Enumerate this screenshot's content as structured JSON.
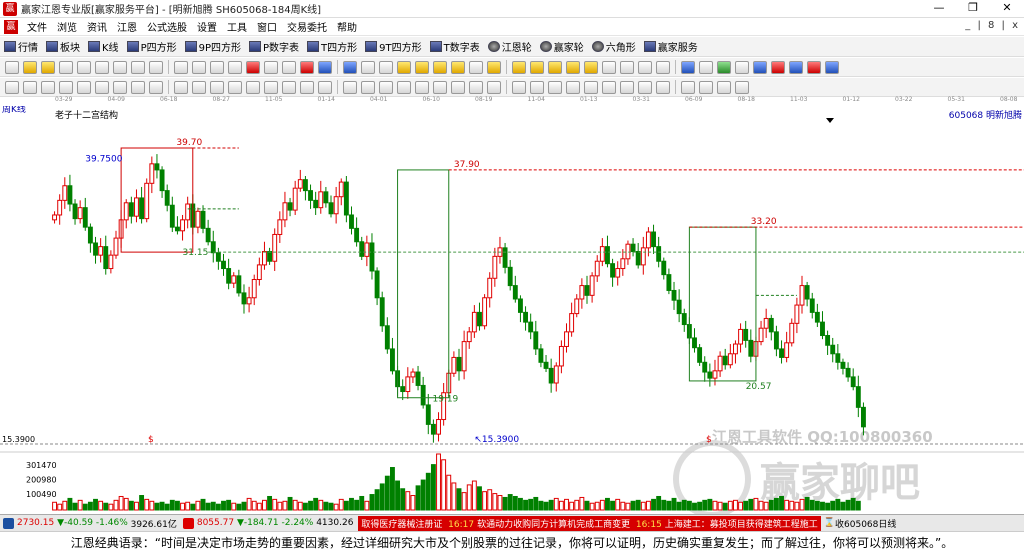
{
  "window": {
    "title": "赢家江恩专业版[赢家服务平台] - [明新旭腾  SH605068-184周K线]",
    "controls": [
      "—",
      "❐",
      "✕"
    ]
  },
  "menu": [
    "文件",
    "浏览",
    "资讯",
    "江恩",
    "公式选股",
    "设置",
    "工具",
    "窗口",
    "交易委托",
    "帮助"
  ],
  "menu_right": "_ | 8 | x",
  "toolbar1": [
    {
      "label": "行情",
      "icon": "quote-icon"
    },
    {
      "label": "板块",
      "icon": "sector-icon"
    },
    {
      "label": "K线",
      "icon": "kline-icon"
    },
    {
      "label": "P四方形",
      "icon": "p-square-icon"
    },
    {
      "label": "9P四方形",
      "icon": "9p-square-icon"
    },
    {
      "label": "P数字表",
      "icon": "p-table-icon"
    },
    {
      "label": "T四方形",
      "icon": "t-square-icon"
    },
    {
      "label": "9T四方形",
      "icon": "9t-square-icon"
    },
    {
      "label": "T数字表",
      "icon": "t-table-icon"
    },
    {
      "label": "江恩轮",
      "icon": "gann-wheel-icon"
    },
    {
      "label": "赢家轮",
      "icon": "winner-wheel-icon"
    },
    {
      "label": "六角形",
      "icon": "hexagon-icon"
    },
    {
      "label": "赢家服务",
      "icon": "service-icon"
    }
  ],
  "datebar_labels": [
    "03-29",
    "04-09",
    "06-18",
    "08-27",
    "11-05",
    "01-14",
    "04-01",
    "06-10",
    "08-19",
    "11-04",
    "01-13",
    "03-31",
    "06-09",
    "08-18",
    "11-03",
    "01-12",
    "03-22",
    "05-31",
    "08-08"
  ],
  "chart_header": {
    "period": "周K线",
    "indicator": "老子十二宫结构",
    "code_name": "605068  明新旭腾"
  },
  "chart_data": {
    "type": "candlestick",
    "annotations": {
      "high1": "39.70",
      "box1_top": "39.7500",
      "box1_low": "31.15",
      "high2": "37.90",
      "low2": "19.19",
      "low_marker": "15.3900",
      "high3": "33.20",
      "low3": "20.57"
    },
    "price_axis_label": "15.3900",
    "volume_axis": [
      "301470",
      "200980",
      "100490"
    ],
    "closes": [
      34.2,
      35.4,
      36.6,
      35.1,
      33.9,
      34.8,
      33.2,
      31.9,
      30.9,
      31.6,
      29.8,
      30.9,
      32.3,
      33.8,
      35.2,
      34.1,
      35.6,
      33.9,
      36.8,
      38.4,
      37.9,
      36.2,
      35.0,
      33.2,
      32.9,
      33.8,
      35.1,
      33.2,
      34.5,
      33.1,
      32.0,
      31.1,
      30.4,
      29.8,
      28.6,
      29.2,
      27.8,
      26.9,
      27.4,
      28.9,
      30.1,
      31.2,
      30.4,
      32.6,
      33.8,
      35.2,
      34.6,
      36.4,
      37.1,
      36.2,
      35.4,
      34.8,
      36.1,
      35.2,
      34.3,
      35.7,
      36.9,
      34.2,
      33.1,
      32.0,
      30.8,
      31.9,
      29.6,
      27.4,
      25.1,
      23.2,
      21.4,
      20.1,
      19.7,
      20.9,
      21.3,
      20.2,
      18.6,
      17.0,
      16.2,
      17.4,
      19.6,
      21.2,
      22.5,
      21.4,
      23.8,
      24.6,
      26.2,
      25.1,
      27.4,
      29.0,
      30.8,
      31.5,
      29.9,
      28.4,
      27.3,
      26.2,
      25.4,
      24.6,
      23.2,
      22.1,
      21.6,
      20.4,
      21.8,
      23.4,
      24.6,
      26.1,
      27.3,
      28.4,
      27.6,
      29.2,
      30.4,
      31.6,
      30.2,
      29.1,
      29.8,
      30.6,
      31.8,
      31.2,
      30.1,
      31.5,
      32.8,
      31.6,
      30.4,
      29.3,
      28.0,
      27.2,
      26.1,
      25.2,
      24.1,
      23.3,
      22.1,
      21.3,
      20.8,
      21.4,
      22.6,
      21.9,
      22.8,
      23.6,
      24.8,
      23.9,
      22.6,
      23.8,
      24.9,
      25.7,
      24.6,
      23.2,
      22.5,
      23.7,
      25.3,
      26.8,
      28.4,
      27.3,
      26.2,
      25.4,
      24.3,
      23.5,
      22.8,
      22.1,
      21.6,
      20.9,
      20.1,
      18.4,
      16.8
    ],
    "volumes": [
      8,
      6,
      9,
      12,
      7,
      10,
      6,
      8,
      11,
      9,
      7,
      6,
      10,
      14,
      12,
      9,
      8,
      15,
      11,
      9,
      7,
      8,
      6,
      10,
      9,
      7,
      8,
      6,
      9,
      11,
      7,
      8,
      6,
      9,
      10,
      7,
      6,
      8,
      12,
      9,
      7,
      10,
      14,
      11,
      8,
      9,
      13,
      10,
      8,
      7,
      9,
      12,
      10,
      8,
      7,
      6,
      11,
      9,
      12,
      10,
      14,
      9,
      16,
      21,
      27,
      35,
      44,
      30,
      22,
      19,
      15,
      25,
      31,
      38,
      47,
      58,
      52,
      36,
      28,
      22,
      18,
      26,
      30,
      24,
      19,
      21,
      17,
      15,
      13,
      16,
      14,
      12,
      10,
      11,
      13,
      9,
      8,
      10,
      12,
      9,
      11,
      8,
      10,
      13,
      9,
      7,
      8,
      10,
      12,
      9,
      11,
      8,
      7,
      9,
      10,
      8,
      9,
      11,
      14,
      10,
      9,
      12,
      8,
      10,
      9,
      7,
      8,
      10,
      11,
      9,
      8,
      7,
      9,
      10,
      8,
      9,
      11,
      12,
      9,
      8,
      10,
      12,
      14,
      10,
      9,
      8,
      11,
      13,
      10,
      9,
      8,
      7,
      9,
      11,
      8,
      10,
      12,
      9
    ],
    "ylim": [
      15.39,
      42.0
    ],
    "colors": {
      "up": "#e00000",
      "down": "#008000",
      "box_high": "#d00000",
      "box_low": "#208020"
    }
  },
  "watermark": {
    "top": "江恩工具软件  QQ:100800360",
    "main": "赢家聊吧"
  },
  "status": {
    "sh_index": "2730.15",
    "sh_change": "▼-40.59",
    "sh_pct": "-1.46%",
    "sh_amount": "3926.61亿",
    "sz_index": "8055.77",
    "sz_change": "▼-184.71",
    "sz_pct": "-2.24%",
    "sz_amount": "4130.26",
    "news1": "取得医疗器械注册证",
    "news2_time": "16:17",
    "news2": "软通动力收购同方计算机完成工商变更",
    "news3_time": "16:15",
    "news3": "上海建工：募投项目获得建筑工程施工",
    "right": "收605068日线"
  },
  "footer_quote": "江恩经典语录：“时间是决定市场走势的重要因素，经过详细研究大市及个别股票的过往记录，你将可以证明，历史确实重复发生；而了解过往，你将可以预测将来。”。"
}
